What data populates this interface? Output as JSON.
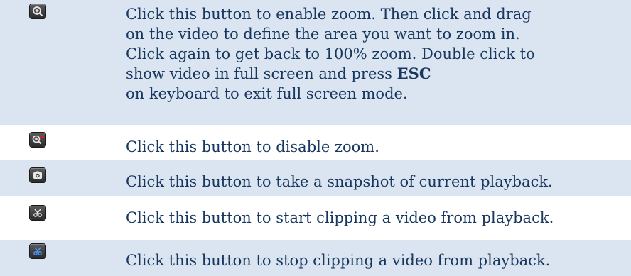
{
  "rows": [
    {
      "icon": "zoom-in-icon",
      "lines": [
        "Click this button to enable zoom. Then click and drag",
        "on the video to define the area you want to zoom in.",
        "Click again to get back to 100% zoom. Double click to",
        "show video in full screen and press",
        "on keyboard to exit full screen mode."
      ],
      "key": "ESC"
    },
    {
      "icon": "zoom-disable-icon",
      "text": "Click this button to disable zoom."
    },
    {
      "icon": "camera-snapshot-icon",
      "text": "Click this button to take a snapshot of current playback."
    },
    {
      "icon": "scissors-start-clip-icon",
      "text": "Click this button to start clipping a video from playback."
    },
    {
      "icon": "scissors-stop-clip-icon",
      "text": "Click this button to stop clipping a video from playback."
    }
  ],
  "colors": {
    "row_shade": "#dbe5f1",
    "text": "#17375e",
    "icon_body": "#3a3a3a",
    "icon_active": "#2a7be4"
  }
}
